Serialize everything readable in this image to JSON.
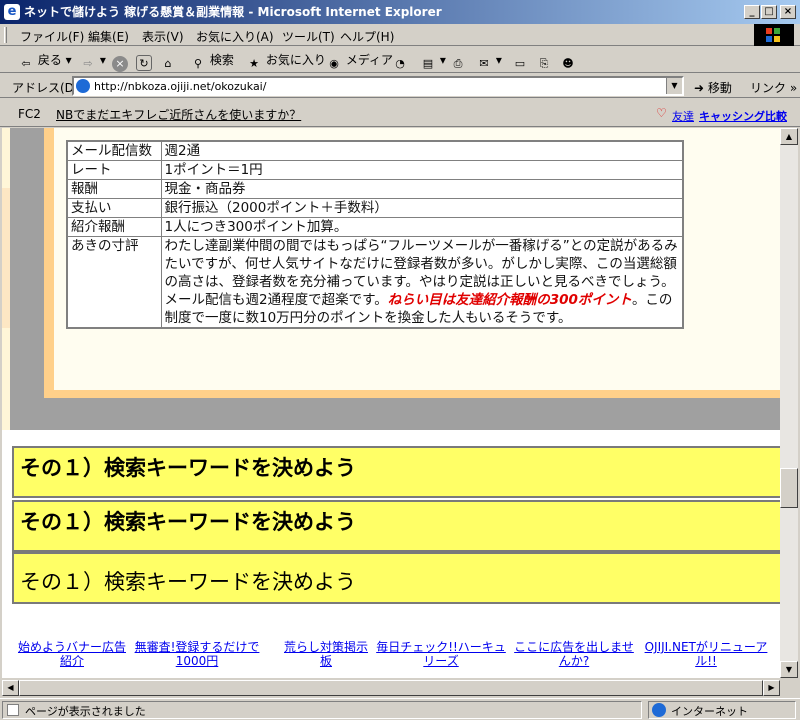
{
  "window": {
    "title": "ネットで儲けよう 稼げる懸賞＆副業情報 - Microsoft Internet Explorer",
    "controls": {
      "minimize": "_",
      "maximize": "□",
      "close": "×"
    }
  },
  "menubar": {
    "items": [
      "ファイル(F)",
      "編集(E)",
      "表示(V)",
      "お気に入り(A)",
      "ツール(T)",
      "ヘルプ(H)"
    ]
  },
  "toolbar": {
    "back": "戻る",
    "search": "検索",
    "favorites": "お気に入り",
    "media": "メディア"
  },
  "addressbar": {
    "label": "アドレス(D)",
    "url": "http://nbkoza.ojiji.net/okozukai/",
    "go": "移動",
    "links": "リンク"
  },
  "fc2bar": {
    "brand": "FC2",
    "ad_text": "NBでまだエキフレご近所さんを使いますか？",
    "friend_link": "友達",
    "caching_link": "キャッシング比較"
  },
  "info_table": {
    "rows": [
      {
        "key": "メール配信数",
        "value": "週2通"
      },
      {
        "key": "レート",
        "value": "1ポイント＝1円"
      },
      {
        "key": "報酬",
        "value": "現金・商品券"
      },
      {
        "key": "支払い",
        "value": "銀行振込（2000ポイント＋手数料）"
      },
      {
        "key": "紹介報酬",
        "value": "1人につき300ポイント加算。"
      }
    ],
    "review": {
      "key": "あきの寸評",
      "text_before": "わたし達副業仲間の間ではもっぱら“フルーツメールが一番稼げる”との定説があるみたいですが、何せ人気サイトなだけに登録者数が多い。がしかし実際、この当選総額の高さは、登録者数を充分補っています。やはり定説は正しいと見るべきでしょう。メール配信も週2通程度で超楽です。",
      "highlight": "ねらい目は友達紹介報酬の300ポイント",
      "text_after": "。この制度で一度に数10万円分のポイントを換金した人もいるそうです。"
    }
  },
  "keyword_boxes": [
    {
      "text": "その１）検索キーワードを決めよう"
    },
    {
      "text": "その１）検索キーワードを決めよう"
    },
    {
      "text": "その１）検索キーワードを決めよう"
    }
  ],
  "footer_links": [
    "始めようバナー広告紹介",
    "無審査!登録するだけで1000円",
    "荒らし対策掲示板",
    "毎日チェック!!ハーキュリーズ",
    "ここに広告を出しませんか?",
    "OJIJI.NETがリニューアル!!"
  ],
  "statusbar": {
    "text": "ページが表示されました",
    "zone": "インターネット"
  },
  "colors": {
    "title_gradient_start": "#0a246a",
    "title_gradient_end": "#a6caf0",
    "keyword_box_bg": "#ffff66",
    "highlight_red": "#e00000",
    "link_blue": "#0000ee"
  }
}
